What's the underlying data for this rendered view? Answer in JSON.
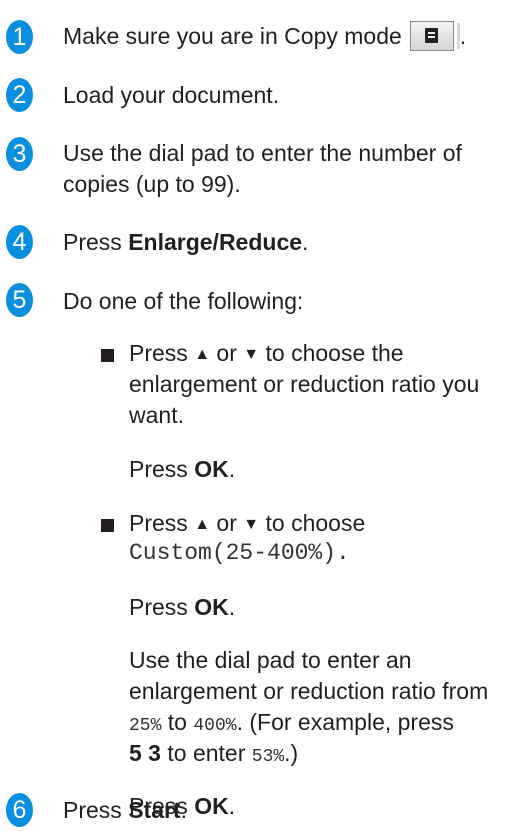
{
  "steps": [
    {
      "num": "1",
      "text": "Make sure you are in Copy mode",
      "after": "."
    },
    {
      "num": "2",
      "text": "Load your document."
    },
    {
      "num": "3",
      "line1": "Use the dial pad to enter the number of",
      "line2": "copies (up to 99)."
    },
    {
      "num": "4",
      "pre": "Press ",
      "bold": "Enlarge/Reduce",
      "post": "."
    },
    {
      "num": "5",
      "text": "Do one of the following:"
    },
    {
      "num": "6",
      "pre": "Press ",
      "bold": "Start",
      "post": "."
    }
  ],
  "options": [
    {
      "line1_pre": "Press ",
      "up": "▲",
      "mid": " or ",
      "down": "▼",
      "line1_post": " to choose the",
      "line2": "enlargement or reduction ratio you",
      "line3": "want.",
      "press_pre": "Press ",
      "press_bold": "OK",
      "press_post": "."
    },
    {
      "line1_pre": "Press ",
      "up": "▲",
      "mid": " or ",
      "down": "▼",
      "line1_post": " to choose",
      "line2_mono": "Custom(25-400%).",
      "press_pre": "Press ",
      "press_bold": "OK",
      "press_post": ".",
      "dial_line1": "Use the dial pad to enter an",
      "dial_line2": "enlargement or reduction ratio from",
      "dial_line3_mono1": "25%",
      "dial_line3_mid": " to ",
      "dial_line3_mono2": "400%",
      "dial_line3_post": ". (For example, press",
      "dial_line4_bold": "5 3",
      "dial_line4_mid": " to enter ",
      "dial_line4_mono": "53%",
      "dial_line4_post": ".)",
      "press2_pre": "Press ",
      "press2_bold": "OK",
      "press2_post": "."
    }
  ],
  "colors": {
    "badge": "#0a8fe0"
  }
}
